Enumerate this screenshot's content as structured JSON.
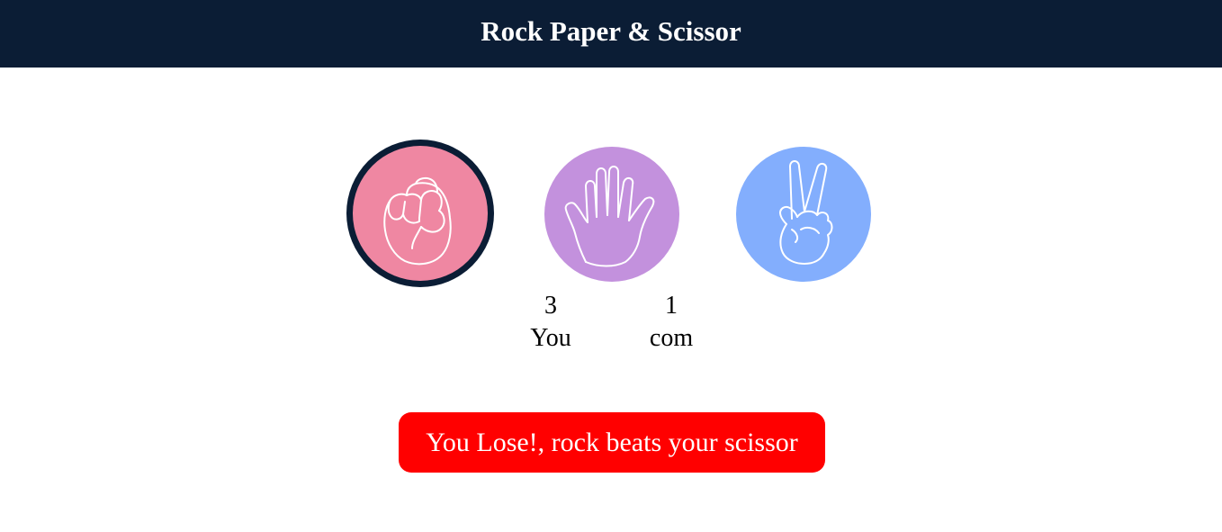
{
  "header": {
    "title": "Rock Paper & Scissor"
  },
  "choices": [
    {
      "id": "rock",
      "icon": "fist-icon",
      "color": "#ef87a2",
      "selected": true
    },
    {
      "id": "paper",
      "icon": "open-hand-icon",
      "color": "#c391dd",
      "selected": false
    },
    {
      "id": "scissor",
      "icon": "peace-hand-icon",
      "color": "#83aefd",
      "selected": false
    }
  ],
  "scoreboard": {
    "user": {
      "score": "3",
      "label": "You"
    },
    "computer": {
      "score": "1",
      "label": "com"
    }
  },
  "message": {
    "text": "You Lose!, rock beats your scissor",
    "color": "#ff0000"
  },
  "colors": {
    "header_bg": "#0b1d35",
    "selection_ring": "#0b1d35"
  }
}
